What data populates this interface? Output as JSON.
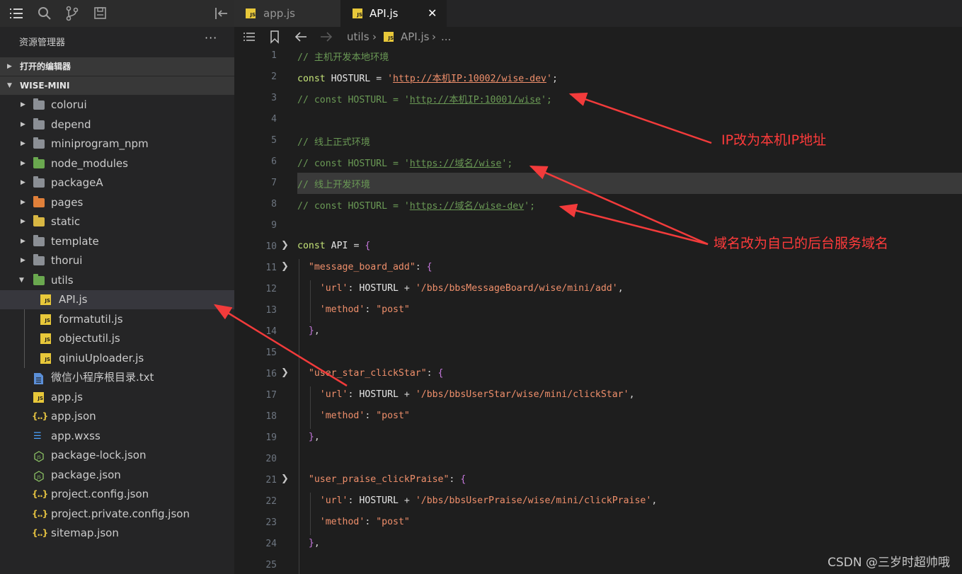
{
  "activity_bar": {
    "icons": [
      "explorer-icon",
      "search-icon",
      "source-control-icon",
      "outline-icon",
      "collapse-icon"
    ]
  },
  "explorer": {
    "title": "资源管理器",
    "more": "···",
    "open_editors": "打开的编辑器",
    "project": "WISE-MINI",
    "items": [
      {
        "label": "colorui",
        "kind": "folder"
      },
      {
        "label": "depend",
        "kind": "folder"
      },
      {
        "label": "miniprogram_npm",
        "kind": "folder"
      },
      {
        "label": "node_modules",
        "kind": "folder-green"
      },
      {
        "label": "packageA",
        "kind": "folder"
      },
      {
        "label": "pages",
        "kind": "folder-orange"
      },
      {
        "label": "static",
        "kind": "folder-yellow"
      },
      {
        "label": "template",
        "kind": "folder"
      },
      {
        "label": "thorui",
        "kind": "folder"
      },
      {
        "label": "utils",
        "kind": "folder-green",
        "expanded": true
      },
      {
        "label": "API.js",
        "kind": "js",
        "selected": true
      },
      {
        "label": "formatutil.js",
        "kind": "js"
      },
      {
        "label": "objectutil.js",
        "kind": "js"
      },
      {
        "label": "qiniuUploader.js",
        "kind": "js"
      },
      {
        "label": "微信小程序根目录.txt",
        "kind": "txt"
      },
      {
        "label": "app.js",
        "kind": "js"
      },
      {
        "label": "app.json",
        "kind": "json"
      },
      {
        "label": "app.wxss",
        "kind": "css"
      },
      {
        "label": "package-lock.json",
        "kind": "npm"
      },
      {
        "label": "package.json",
        "kind": "npm"
      },
      {
        "label": "project.config.json",
        "kind": "json"
      },
      {
        "label": "project.private.config.json",
        "kind": "json"
      },
      {
        "label": "sitemap.json",
        "kind": "json"
      }
    ]
  },
  "tabs": [
    {
      "label": "app.js",
      "active": false
    },
    {
      "label": "API.js",
      "active": true
    }
  ],
  "tab_close": "✕",
  "breadcrumb": {
    "folder": "utils",
    "file": "API.js",
    "more": "..."
  },
  "line_numbers": [
    "1",
    "2",
    "3",
    "4",
    "5",
    "6",
    "7",
    "8",
    "9",
    "10",
    "11",
    "12",
    "13",
    "14",
    "15",
    "16",
    "17",
    "18",
    "19",
    "20",
    "21",
    "22",
    "23",
    "24",
    "25"
  ],
  "code": {
    "l1": "// 主机开发本地环境",
    "l2_kw": "const",
    "l2_var": "HOSTURL",
    "l2_op": "=",
    "l2_url": "http://本机IP:10002/wise-dev",
    "l3_pre": "// const HOSTURL = '",
    "l3_url": "http://本机IP:10001/wise",
    "l3_post": "';",
    "l5": "// 线上正式环境",
    "l6_pre": "// const HOSTURL = '",
    "l6_url": "https://域名/wise",
    "l6_post": "';",
    "l7": "// 线上开发环境",
    "l8_pre": "// const HOSTURL = '",
    "l8_url": "https://域名/wise-dev",
    "l8_post": "';",
    "l10_kw": "const",
    "l10_var": "API",
    "api_keys": [
      "message_board_add",
      "user_star_clickStar",
      "user_praise_clickPraise"
    ],
    "url_key": "url",
    "method_key": "method",
    "hosturl": "HOSTURL",
    "plus": "+",
    "paths": [
      "/bbs/bbsMessageBoard/wise/mini/add",
      "/bbs/bbsUserStar/wise/mini/clickStar",
      "/bbs/bbsUserPraise/wise/mini/clickPraise"
    ],
    "method_val": "post"
  },
  "annotations": {
    "ip_note": "IP改为本机IP地址",
    "domain_note": "域名改为自己的后台服务域名"
  },
  "watermark": "CSDN @三岁时超帅哦",
  "colors": {
    "annotation": "#ff3b3b",
    "comment": "#6a9955",
    "keyword": "#c5e478",
    "string": "#ef8f6b"
  }
}
